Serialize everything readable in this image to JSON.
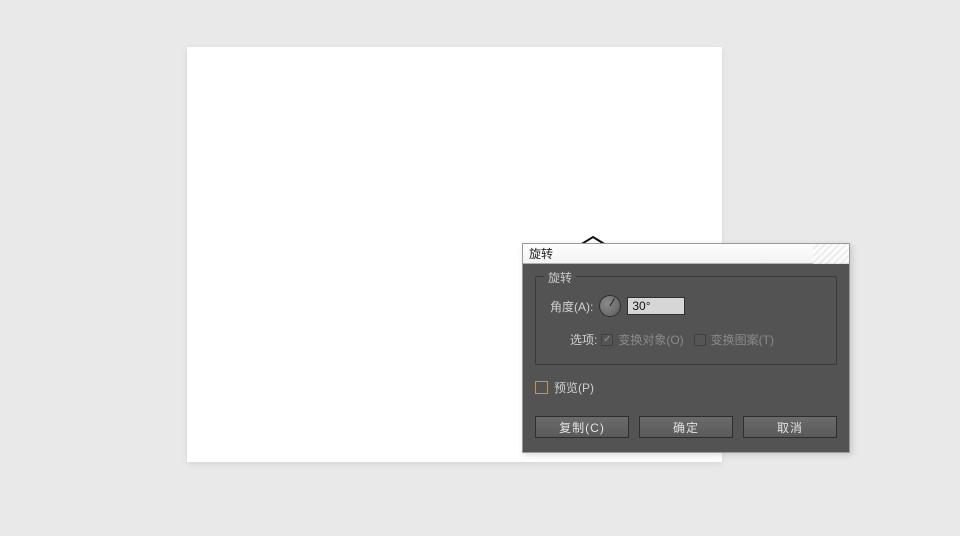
{
  "canvas": {
    "shape": "hexagon"
  },
  "dialog": {
    "title": "旋转",
    "fieldset_legend": "旋转",
    "angle_label": "角度(A):",
    "angle_value": "30°",
    "options_label": "选项:",
    "transform_object_label": "变换对象(O)",
    "transform_object_checked": true,
    "transform_pattern_label": "变换图案(T)",
    "transform_pattern_checked": false,
    "preview_label": "预览(P)",
    "preview_checked": false,
    "buttons": {
      "copy": "复制(C)",
      "ok": "确定",
      "cancel": "取消"
    }
  }
}
